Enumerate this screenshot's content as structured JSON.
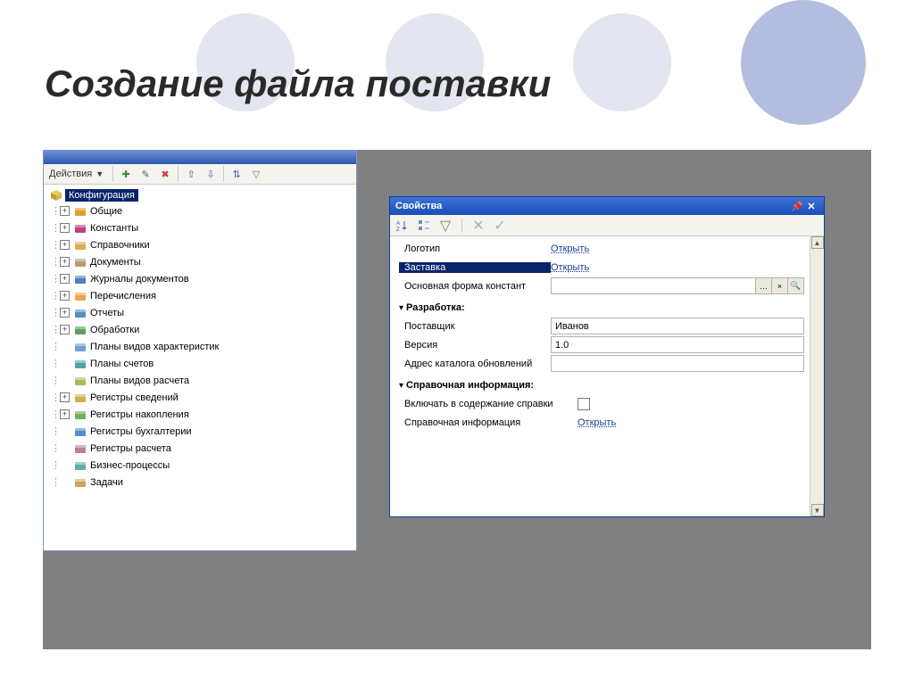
{
  "page": {
    "title": "Создание файла поставки"
  },
  "config": {
    "actions_label": "Действия",
    "root_label": "Конфигурация",
    "items": [
      {
        "label": "Общие",
        "expandable": true,
        "icon": "brick-icon",
        "color": "#d8a030"
      },
      {
        "label": "Константы",
        "expandable": true,
        "icon": "pi-icon",
        "color": "#c04080"
      },
      {
        "label": "Справочники",
        "expandable": true,
        "icon": "book-icon",
        "color": "#d8b050"
      },
      {
        "label": "Документы",
        "expandable": true,
        "icon": "doc-icon",
        "color": "#b0a070"
      },
      {
        "label": "Журналы документов",
        "expandable": true,
        "icon": "journal-icon",
        "color": "#5080c0"
      },
      {
        "label": "Перечисления",
        "expandable": true,
        "icon": "list-icon",
        "color": "#e8a850"
      },
      {
        "label": "Отчеты",
        "expandable": true,
        "icon": "report-icon",
        "color": "#5090c0"
      },
      {
        "label": "Обработки",
        "expandable": true,
        "icon": "gear-icon",
        "color": "#60a060"
      },
      {
        "label": "Планы видов характеристик",
        "expandable": false,
        "icon": "plan-icon",
        "color": "#70a0d0"
      },
      {
        "label": "Планы счетов",
        "expandable": false,
        "icon": "accounts-icon",
        "color": "#50a0b0"
      },
      {
        "label": "Планы видов расчета",
        "expandable": false,
        "icon": "calc-plan-icon",
        "color": "#a0c060"
      },
      {
        "label": "Регистры сведений",
        "expandable": true,
        "icon": "reg-info-icon",
        "color": "#d0b050"
      },
      {
        "label": "Регистры накопления",
        "expandable": true,
        "icon": "reg-accum-icon",
        "color": "#70b060"
      },
      {
        "label": "Регистры бухгалтерии",
        "expandable": false,
        "icon": "reg-acc-icon",
        "color": "#5090d0"
      },
      {
        "label": "Регистры расчета",
        "expandable": false,
        "icon": "reg-calc-icon",
        "color": "#c08090"
      },
      {
        "label": "Бизнес-процессы",
        "expandable": false,
        "icon": "process-icon",
        "color": "#60b0a0"
      },
      {
        "label": "Задачи",
        "expandable": false,
        "icon": "task-icon",
        "color": "#d0a060"
      }
    ]
  },
  "props": {
    "title": "Свойства",
    "rows": {
      "logo": {
        "label": "Логотип",
        "link": "Открыть"
      },
      "splash": {
        "label": "Заставка",
        "link": "Открыть"
      },
      "const_form": {
        "label": "Основная форма констант"
      }
    },
    "dev_section": "Разработка:",
    "dev": {
      "vendor_label": "Поставщик",
      "vendor_value": "Иванов",
      "version_label": "Версия",
      "version_value": "1.0",
      "update_label": "Адрес каталога обновлений",
      "update_value": ""
    },
    "help_section": "Справочная информация:",
    "help": {
      "include_label": "Включать в содержание справки",
      "info_label": "Справочная информация",
      "info_link": "Открыть"
    }
  }
}
